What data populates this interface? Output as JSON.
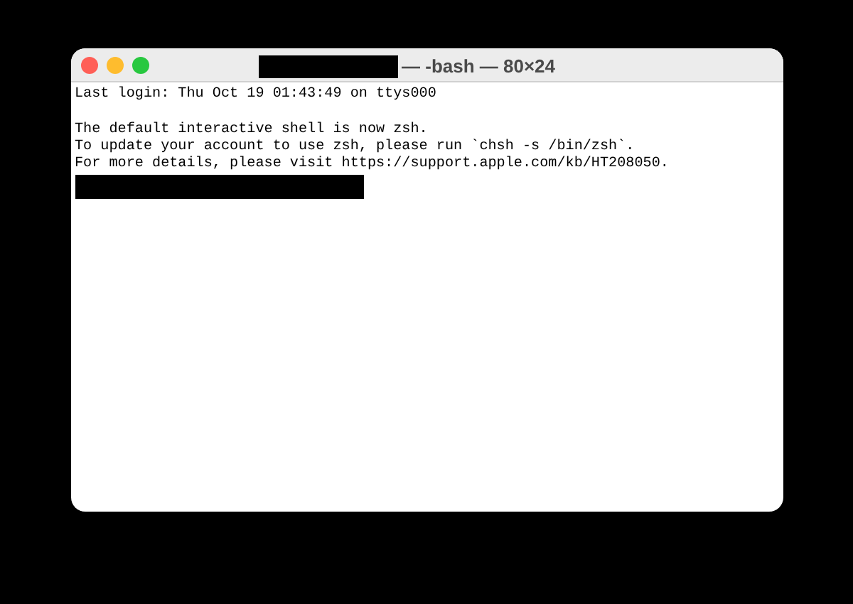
{
  "window": {
    "title": "— -bash — 80×24"
  },
  "terminal": {
    "login_line": "Last login: Thu Oct 19 01:43:49 on ttys000",
    "message_lines": [
      "The default interactive shell is now zsh.",
      "To update your account to use zsh, please run `chsh -s /bin/zsh`.",
      "For more details, please visit https://support.apple.com/kb/HT208050."
    ]
  }
}
